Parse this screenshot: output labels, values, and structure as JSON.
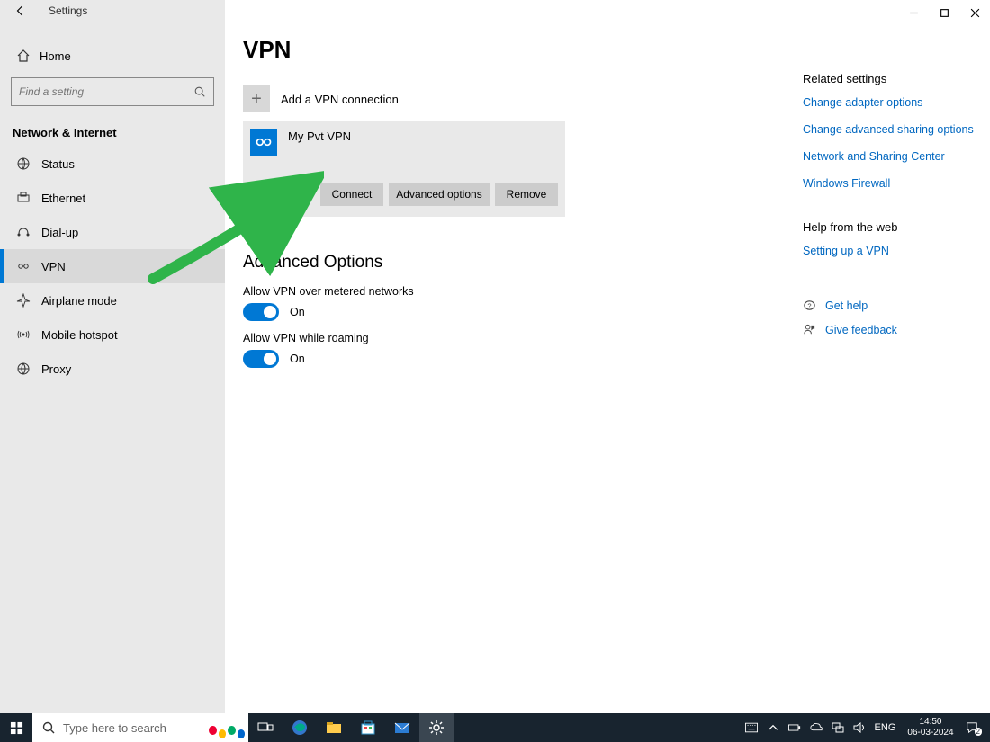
{
  "window": {
    "app_title": "Settings"
  },
  "sidebar": {
    "home_label": "Home",
    "search_placeholder": "Find a setting",
    "section_label": "Network & Internet",
    "items": [
      {
        "label": "Status"
      },
      {
        "label": "Ethernet"
      },
      {
        "label": "Dial-up"
      },
      {
        "label": "VPN"
      },
      {
        "label": "Airplane mode"
      },
      {
        "label": "Mobile hotspot"
      },
      {
        "label": "Proxy"
      }
    ],
    "active_index": 3
  },
  "main": {
    "title": "VPN",
    "add_label": "Add a VPN connection",
    "vpn_entry": {
      "name": "My Pvt VPN",
      "connect_label": "Connect",
      "advanced_label": "Advanced options",
      "remove_label": "Remove"
    },
    "advanced_section_title": "Advanced Options",
    "options": [
      {
        "label": "Allow VPN over metered networks",
        "state": "On"
      },
      {
        "label": "Allow VPN while roaming",
        "state": "On"
      }
    ]
  },
  "right": {
    "related_title": "Related settings",
    "links": [
      "Change adapter options",
      "Change advanced sharing options",
      "Network and Sharing Center",
      "Windows Firewall"
    ],
    "help_title": "Help from the web",
    "help_links": [
      "Setting up a VPN"
    ],
    "get_help": "Get help",
    "give_feedback": "Give feedback"
  },
  "taskbar": {
    "search_placeholder": "Type here to search",
    "lang": "ENG",
    "time": "14:50",
    "date": "06-03-2024",
    "notif_count": "2"
  }
}
